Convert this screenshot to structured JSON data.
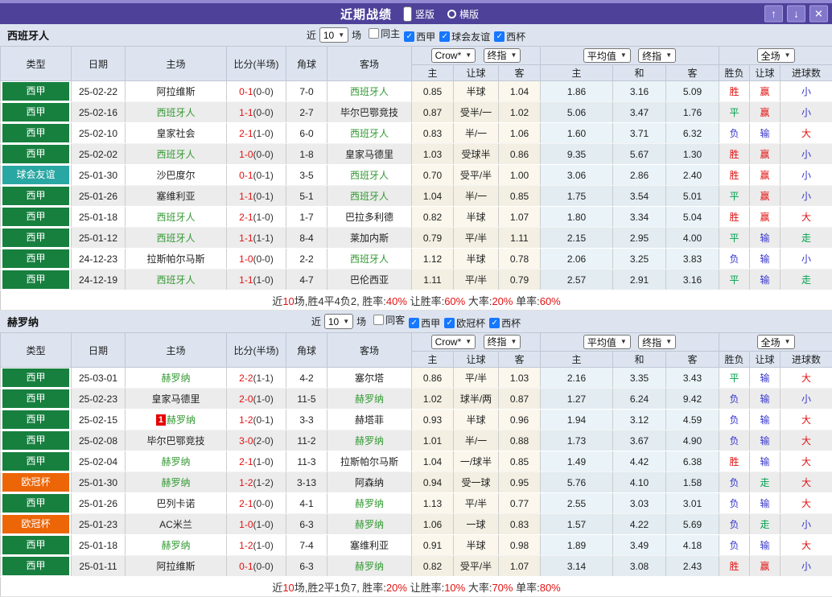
{
  "titlebar": {
    "title": "近期战绩",
    "radios": [
      {
        "label": "竖版",
        "selected": true
      },
      {
        "label": "横版",
        "selected": false
      }
    ],
    "buttons": {
      "up": "↑",
      "down": "↓",
      "close": "✕"
    }
  },
  "labels": {
    "near": "近",
    "games": "场",
    "col_type": "类型",
    "col_date": "日期",
    "col_home": "主场",
    "col_score": "比分(半场)",
    "col_corner": "角球",
    "col_away": "客场",
    "sub": [
      "主",
      "让球",
      "客",
      "主",
      "和",
      "客",
      "胜负",
      "让球",
      "进球数"
    ],
    "sel_crow": "Crow*",
    "sel_final": "终指",
    "sel_avg": "平均值",
    "sel_full": "全场"
  },
  "colors": {
    "titlebar_purple": "#4e4199",
    "league_liga": "#17803f",
    "league_friendly": "#29a7a3",
    "league_ucl": "#ec6608",
    "team_highlight": "#339933",
    "result_red": "#e11111",
    "result_green": "#00a14b",
    "result_blue": "#3636cc",
    "checkbox_blue": "#1677ff"
  },
  "tables": [
    {
      "team": "西班牙人",
      "filter": {
        "count": "10",
        "same": {
          "label": "同主",
          "checked": false
        },
        "comps": [
          {
            "label": "西甲",
            "checked": true
          },
          {
            "label": "球会友谊",
            "checked": true
          },
          {
            "label": "西杯",
            "checked": true
          }
        ]
      },
      "rows": [
        {
          "league": "西甲",
          "lt": "liga",
          "date": "25-02-22",
          "home": "阿拉维斯",
          "hh": false,
          "rc": null,
          "score": "0-1",
          "half": "(0-0)",
          "corner": "7-0",
          "away": "西班牙人",
          "ah": true,
          "o1": "0.85",
          "o2": "半球",
          "o3": "1.04",
          "a1": "1.86",
          "a2": "3.16",
          "a3": "5.09",
          "r1": [
            "胜",
            "r"
          ],
          "r2": [
            "赢",
            "r"
          ],
          "r3": [
            "小",
            "b"
          ]
        },
        {
          "league": "西甲",
          "lt": "liga",
          "date": "25-02-16",
          "home": "西班牙人",
          "hh": true,
          "rc": null,
          "score": "1-1",
          "half": "(0-0)",
          "corner": "2-7",
          "away": "毕尔巴鄂竞技",
          "ah": false,
          "o1": "0.87",
          "o2": "受半/一",
          "o3": "1.02",
          "a1": "5.06",
          "a2": "3.47",
          "a3": "1.76",
          "r1": [
            "平",
            "g"
          ],
          "r2": [
            "赢",
            "r"
          ],
          "r3": [
            "小",
            "b"
          ]
        },
        {
          "league": "西甲",
          "lt": "liga",
          "date": "25-02-10",
          "home": "皇家社会",
          "hh": false,
          "rc": null,
          "score": "2-1",
          "half": "(1-0)",
          "corner": "6-0",
          "away": "西班牙人",
          "ah": true,
          "o1": "0.83",
          "o2": "半/一",
          "o3": "1.06",
          "a1": "1.60",
          "a2": "3.71",
          "a3": "6.32",
          "r1": [
            "负",
            "b"
          ],
          "r2": [
            "输",
            "b"
          ],
          "r3": [
            "大",
            "r"
          ]
        },
        {
          "league": "西甲",
          "lt": "liga",
          "date": "25-02-02",
          "home": "西班牙人",
          "hh": true,
          "rc": null,
          "score": "1-0",
          "half": "(0-0)",
          "corner": "1-8",
          "away": "皇家马德里",
          "ah": false,
          "o1": "1.03",
          "o2": "受球半",
          "o3": "0.86",
          "a1": "9.35",
          "a2": "5.67",
          "a3": "1.30",
          "r1": [
            "胜",
            "r"
          ],
          "r2": [
            "赢",
            "r"
          ],
          "r3": [
            "小",
            "b"
          ]
        },
        {
          "league": "球会友谊",
          "lt": "friendly",
          "date": "25-01-30",
          "home": "沙巴度尔",
          "hh": false,
          "rc": null,
          "score": "0-1",
          "half": "(0-1)",
          "corner": "3-5",
          "away": "西班牙人",
          "ah": true,
          "o1": "0.70",
          "o2": "受平/半",
          "o3": "1.00",
          "a1": "3.06",
          "a2": "2.86",
          "a3": "2.40",
          "r1": [
            "胜",
            "r"
          ],
          "r2": [
            "赢",
            "r"
          ],
          "r3": [
            "小",
            "b"
          ]
        },
        {
          "league": "西甲",
          "lt": "liga",
          "date": "25-01-26",
          "home": "塞维利亚",
          "hh": false,
          "rc": null,
          "score": "1-1",
          "half": "(0-1)",
          "corner": "5-1",
          "away": "西班牙人",
          "ah": true,
          "o1": "1.04",
          "o2": "半/一",
          "o3": "0.85",
          "a1": "1.75",
          "a2": "3.54",
          "a3": "5.01",
          "r1": [
            "平",
            "g"
          ],
          "r2": [
            "赢",
            "r"
          ],
          "r3": [
            "小",
            "b"
          ]
        },
        {
          "league": "西甲",
          "lt": "liga",
          "date": "25-01-18",
          "home": "西班牙人",
          "hh": true,
          "rc": null,
          "score": "2-1",
          "half": "(1-0)",
          "corner": "1-7",
          "away": "巴拉多利德",
          "ah": false,
          "o1": "0.82",
          "o2": "半球",
          "o3": "1.07",
          "a1": "1.80",
          "a2": "3.34",
          "a3": "5.04",
          "r1": [
            "胜",
            "r"
          ],
          "r2": [
            "赢",
            "r"
          ],
          "r3": [
            "大",
            "r"
          ]
        },
        {
          "league": "西甲",
          "lt": "liga",
          "date": "25-01-12",
          "home": "西班牙人",
          "hh": true,
          "rc": null,
          "score": "1-1",
          "half": "(1-1)",
          "corner": "8-4",
          "away": "莱加内斯",
          "ah": false,
          "o1": "0.79",
          "o2": "平/半",
          "o3": "1.11",
          "a1": "2.15",
          "a2": "2.95",
          "a3": "4.00",
          "r1": [
            "平",
            "g"
          ],
          "r2": [
            "输",
            "b"
          ],
          "r3": [
            "走",
            "g"
          ]
        },
        {
          "league": "西甲",
          "lt": "liga",
          "date": "24-12-23",
          "home": "拉斯帕尔马斯",
          "hh": false,
          "rc": null,
          "score": "1-0",
          "half": "(0-0)",
          "corner": "2-2",
          "away": "西班牙人",
          "ah": true,
          "o1": "1.12",
          "o2": "半球",
          "o3": "0.78",
          "a1": "2.06",
          "a2": "3.25",
          "a3": "3.83",
          "r1": [
            "负",
            "b"
          ],
          "r2": [
            "输",
            "b"
          ],
          "r3": [
            "小",
            "b"
          ]
        },
        {
          "league": "西甲",
          "lt": "liga",
          "date": "24-12-19",
          "home": "西班牙人",
          "hh": true,
          "rc": null,
          "score": "1-1",
          "half": "(1-0)",
          "corner": "4-7",
          "away": "巴伦西亚",
          "ah": false,
          "o1": "1.11",
          "o2": "平/半",
          "o3": "0.79",
          "a1": "2.57",
          "a2": "2.91",
          "a3": "3.16",
          "r1": [
            "平",
            "g"
          ],
          "r2": [
            "输",
            "b"
          ],
          "r3": [
            "走",
            "g"
          ]
        }
      ],
      "summary": [
        [
          "近",
          false
        ],
        [
          "10",
          true
        ],
        [
          "场,胜4平4负2, 胜率:",
          false
        ],
        [
          "40%",
          true
        ],
        [
          " 让胜率:",
          false
        ],
        [
          "60%",
          true
        ],
        [
          " 大率:",
          false
        ],
        [
          "20%",
          true
        ],
        [
          " 单率:",
          false
        ],
        [
          "60%",
          true
        ]
      ]
    },
    {
      "team": "赫罗纳",
      "filter": {
        "count": "10",
        "same": {
          "label": "同客",
          "checked": false
        },
        "comps": [
          {
            "label": "西甲",
            "checked": true
          },
          {
            "label": "欧冠杯",
            "checked": true
          },
          {
            "label": "西杯",
            "checked": true
          }
        ]
      },
      "rows": [
        {
          "league": "西甲",
          "lt": "liga",
          "date": "25-03-01",
          "home": "赫罗纳",
          "hh": true,
          "rc": null,
          "score": "2-2",
          "half": "(1-1)",
          "corner": "4-2",
          "away": "塞尔塔",
          "ah": false,
          "o1": "0.86",
          "o2": "平/半",
          "o3": "1.03",
          "a1": "2.16",
          "a2": "3.35",
          "a3": "3.43",
          "r1": [
            "平",
            "g"
          ],
          "r2": [
            "输",
            "b"
          ],
          "r3": [
            "大",
            "r"
          ]
        },
        {
          "league": "西甲",
          "lt": "liga",
          "date": "25-02-23",
          "home": "皇家马德里",
          "hh": false,
          "rc": null,
          "score": "2-0",
          "half": "(1-0)",
          "corner": "11-5",
          "away": "赫罗纳",
          "ah": true,
          "o1": "1.02",
          "o2": "球半/两",
          "o3": "0.87",
          "a1": "1.27",
          "a2": "6.24",
          "a3": "9.42",
          "r1": [
            "负",
            "b"
          ],
          "r2": [
            "输",
            "b"
          ],
          "r3": [
            "小",
            "b"
          ]
        },
        {
          "league": "西甲",
          "lt": "liga",
          "date": "25-02-15",
          "home": "赫罗纳",
          "hh": true,
          "rc": "1",
          "score": "1-2",
          "half": "(0-1)",
          "corner": "3-3",
          "away": "赫塔菲",
          "ah": false,
          "o1": "0.93",
          "o2": "半球",
          "o3": "0.96",
          "a1": "1.94",
          "a2": "3.12",
          "a3": "4.59",
          "r1": [
            "负",
            "b"
          ],
          "r2": [
            "输",
            "b"
          ],
          "r3": [
            "大",
            "r"
          ]
        },
        {
          "league": "西甲",
          "lt": "liga",
          "date": "25-02-08",
          "home": "毕尔巴鄂竞技",
          "hh": false,
          "rc": null,
          "score": "3-0",
          "half": "(2-0)",
          "corner": "11-2",
          "away": "赫罗纳",
          "ah": true,
          "o1": "1.01",
          "o2": "半/一",
          "o3": "0.88",
          "a1": "1.73",
          "a2": "3.67",
          "a3": "4.90",
          "r1": [
            "负",
            "b"
          ],
          "r2": [
            "输",
            "b"
          ],
          "r3": [
            "大",
            "r"
          ]
        },
        {
          "league": "西甲",
          "lt": "liga",
          "date": "25-02-04",
          "home": "赫罗纳",
          "hh": true,
          "rc": null,
          "score": "2-1",
          "half": "(1-0)",
          "corner": "11-3",
          "away": "拉斯帕尔马斯",
          "ah": false,
          "o1": "1.04",
          "o2": "一/球半",
          "o3": "0.85",
          "a1": "1.49",
          "a2": "4.42",
          "a3": "6.38",
          "r1": [
            "胜",
            "r"
          ],
          "r2": [
            "输",
            "b"
          ],
          "r3": [
            "大",
            "r"
          ]
        },
        {
          "league": "欧冠杯",
          "lt": "ucl",
          "date": "25-01-30",
          "home": "赫罗纳",
          "hh": true,
          "rc": null,
          "score": "1-2",
          "half": "(1-2)",
          "corner": "3-13",
          "away": "阿森纳",
          "ah": false,
          "o1": "0.94",
          "o2": "受一球",
          "o3": "0.95",
          "a1": "5.76",
          "a2": "4.10",
          "a3": "1.58",
          "r1": [
            "负",
            "b"
          ],
          "r2": [
            "走",
            "g"
          ],
          "r3": [
            "大",
            "r"
          ]
        },
        {
          "league": "西甲",
          "lt": "liga",
          "date": "25-01-26",
          "home": "巴列卡诺",
          "hh": false,
          "rc": null,
          "score": "2-1",
          "half": "(0-0)",
          "corner": "4-1",
          "away": "赫罗纳",
          "ah": true,
          "o1": "1.13",
          "o2": "平/半",
          "o3": "0.77",
          "a1": "2.55",
          "a2": "3.03",
          "a3": "3.01",
          "r1": [
            "负",
            "b"
          ],
          "r2": [
            "输",
            "b"
          ],
          "r3": [
            "大",
            "r"
          ]
        },
        {
          "league": "欧冠杯",
          "lt": "ucl",
          "date": "25-01-23",
          "home": "AC米兰",
          "hh": false,
          "rc": null,
          "score": "1-0",
          "half": "(1-0)",
          "corner": "6-3",
          "away": "赫罗纳",
          "ah": true,
          "o1": "1.06",
          "o2": "一球",
          "o3": "0.83",
          "a1": "1.57",
          "a2": "4.22",
          "a3": "5.69",
          "r1": [
            "负",
            "b"
          ],
          "r2": [
            "走",
            "g"
          ],
          "r3": [
            "小",
            "b"
          ]
        },
        {
          "league": "西甲",
          "lt": "liga",
          "date": "25-01-18",
          "home": "赫罗纳",
          "hh": true,
          "rc": null,
          "score": "1-2",
          "half": "(1-0)",
          "corner": "7-4",
          "away": "塞维利亚",
          "ah": false,
          "o1": "0.91",
          "o2": "半球",
          "o3": "0.98",
          "a1": "1.89",
          "a2": "3.49",
          "a3": "4.18",
          "r1": [
            "负",
            "b"
          ],
          "r2": [
            "输",
            "b"
          ],
          "r3": [
            "大",
            "r"
          ]
        },
        {
          "league": "西甲",
          "lt": "liga",
          "date": "25-01-11",
          "home": "阿拉维斯",
          "hh": false,
          "rc": null,
          "score": "0-1",
          "half": "(0-0)",
          "corner": "6-3",
          "away": "赫罗纳",
          "ah": true,
          "o1": "0.82",
          "o2": "受平/半",
          "o3": "1.07",
          "a1": "3.14",
          "a2": "3.08",
          "a3": "2.43",
          "r1": [
            "胜",
            "r"
          ],
          "r2": [
            "赢",
            "r"
          ],
          "r3": [
            "小",
            "b"
          ]
        }
      ],
      "summary": [
        [
          "近",
          false
        ],
        [
          "10",
          true
        ],
        [
          "场,胜2平1负7, 胜率:",
          false
        ],
        [
          "20%",
          true
        ],
        [
          " 让胜率:",
          false
        ],
        [
          "10%",
          true
        ],
        [
          " 大率:",
          false
        ],
        [
          "70%",
          true
        ],
        [
          " 单率:",
          false
        ],
        [
          "80%",
          true
        ]
      ]
    }
  ]
}
